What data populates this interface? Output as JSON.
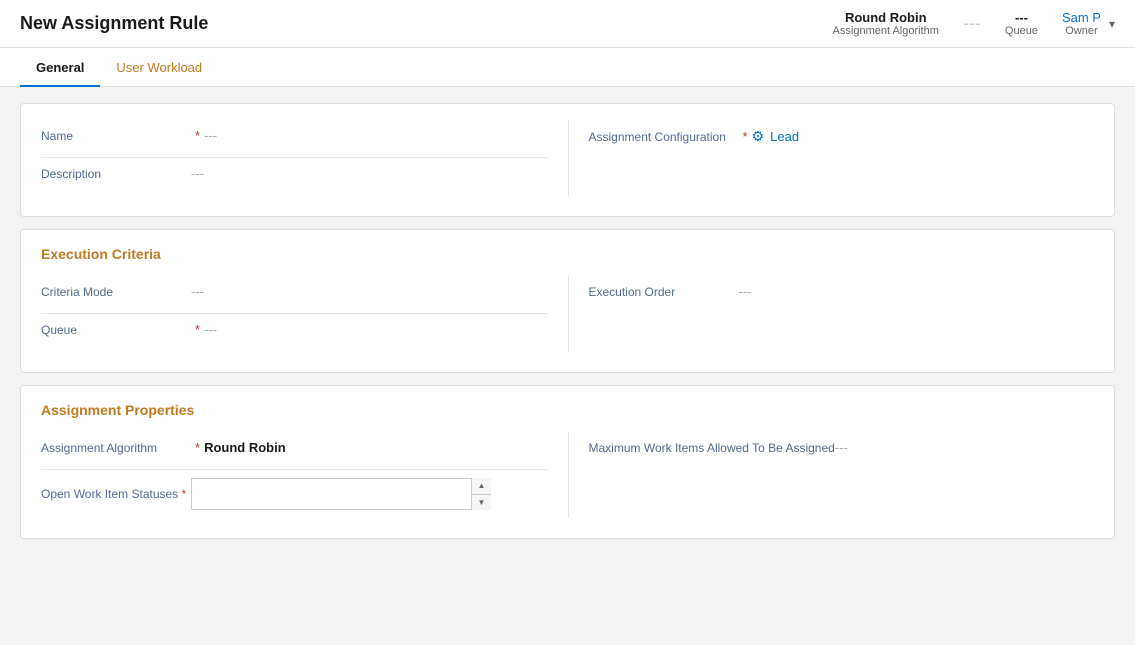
{
  "header": {
    "title": "New Assignment Rule",
    "meta": {
      "algorithm": {
        "value": "Round Robin",
        "label": "Assignment Algorithm"
      },
      "queue": {
        "value": "---",
        "label": "Queue"
      },
      "owner": {
        "value": "Sam P",
        "label": "Owner"
      }
    }
  },
  "tabs": [
    {
      "id": "general",
      "label": "General",
      "active": true
    },
    {
      "id": "user-workload",
      "label": "User Workload",
      "active": false
    }
  ],
  "general_section": {
    "fields": {
      "name_label": "Name",
      "name_value": "---",
      "description_label": "Description",
      "description_value": "---",
      "assignment_config_label": "Assignment Configuration",
      "assignment_config_required": "*",
      "assignment_config_value": "Lead"
    }
  },
  "execution_criteria": {
    "section_title": "Execution Criteria",
    "criteria_mode_label": "Criteria Mode",
    "criteria_mode_value": "---",
    "execution_order_label": "Execution Order",
    "execution_order_value": "---",
    "queue_label": "Queue",
    "queue_value": "---"
  },
  "assignment_properties": {
    "section_title": "Assignment Properties",
    "algorithm_label": "Assignment Algorithm",
    "algorithm_value": "Round Robin",
    "max_work_label": "Maximum Work Items Allowed To Be Assigned",
    "max_work_value": "---",
    "open_work_label": "Open Work Item Statuses",
    "open_work_placeholder": ""
  },
  "icons": {
    "chevron_down": "▾",
    "person": "⚙",
    "arrow_up": "▲",
    "arrow_down": "▼"
  },
  "colors": {
    "accent_blue": "#0070d2",
    "required_red": "#c23934",
    "label_color": "#54698d",
    "section_title_color": "#c07a20",
    "link_color": "#0070d2"
  }
}
